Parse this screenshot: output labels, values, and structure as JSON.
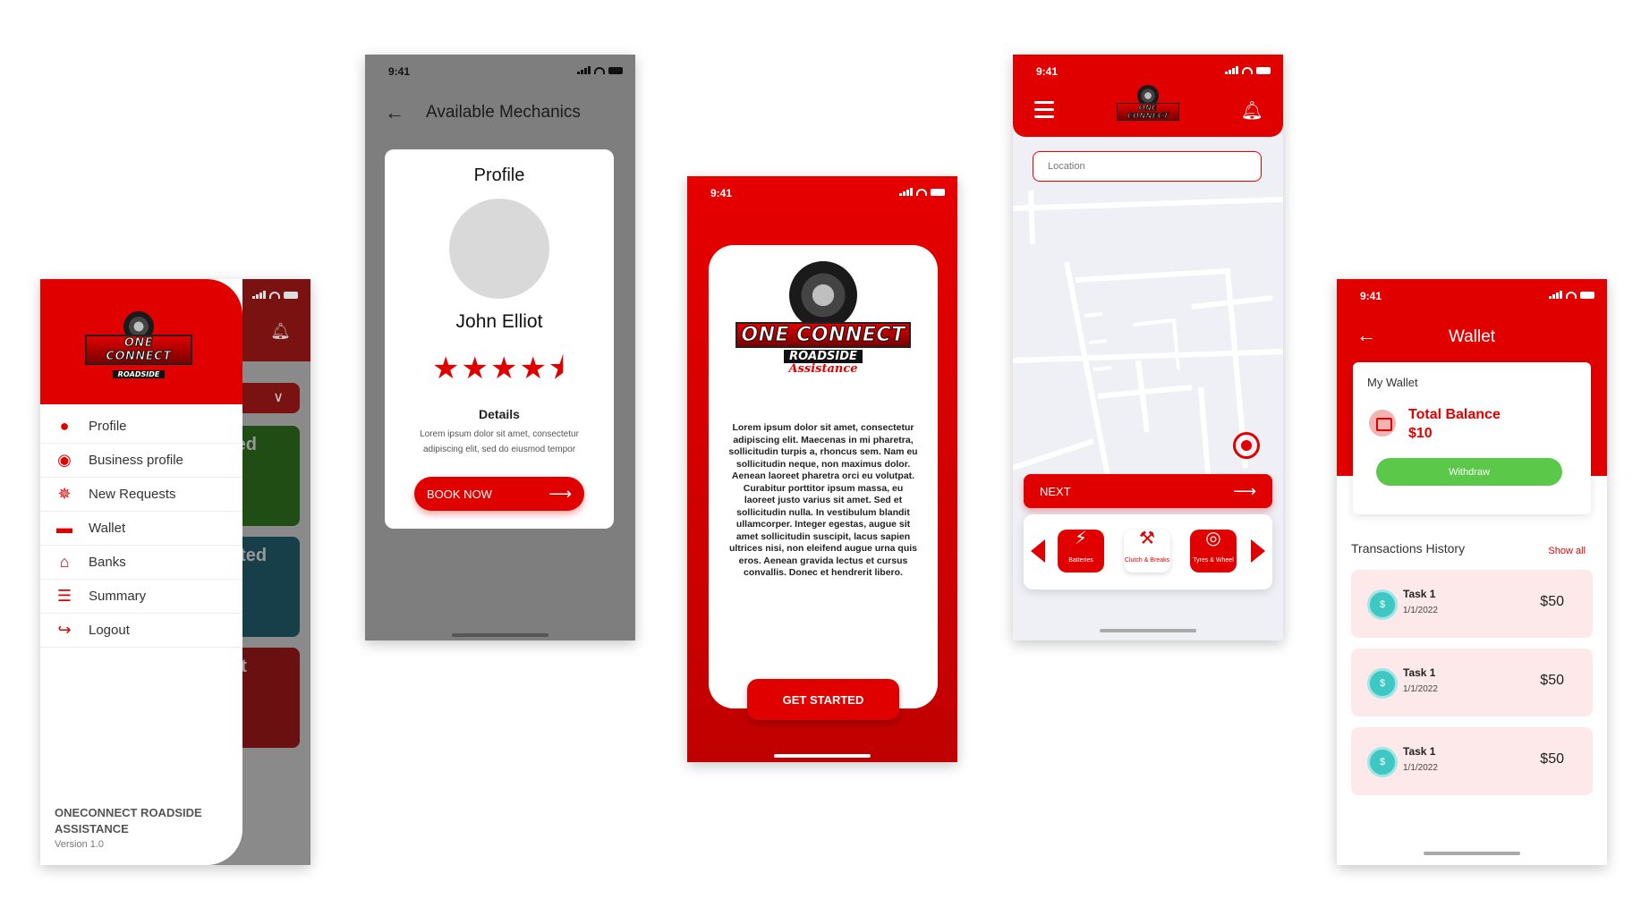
{
  "status_time": "9:41",
  "colors": {
    "brand_red": "#e00000",
    "withdraw_green": "#5cc84a",
    "coin_teal": "#3fc7c4"
  },
  "logo": {
    "line1": "ONE CONNECT",
    "line2": "ROADSIDE",
    "line3": "Assistance"
  },
  "menu_screen": {
    "items": [
      {
        "label": "Profile",
        "icon": "user-icon"
      },
      {
        "label": "Business profile",
        "icon": "steering-wheel-icon"
      },
      {
        "label": "New Requests",
        "icon": "spinner-icon"
      },
      {
        "label": "Wallet",
        "icon": "wallet-icon"
      },
      {
        "label": "Banks",
        "icon": "bank-icon"
      },
      {
        "label": "Summary",
        "icon": "document-icon"
      },
      {
        "label": "Logout",
        "icon": "logout-icon"
      }
    ],
    "footer_title": "ONECONNECT ROADSIDE ASSISTANCE",
    "footer_version": "Version 1.0",
    "background_fragments": [
      "ted",
      "ated",
      "nt"
    ]
  },
  "mechanics_screen": {
    "title": "Available Mechanics",
    "modal_title": "Profile",
    "name": "John Elliot",
    "rating": 4.5,
    "rating_max": 5,
    "details_heading": "Details",
    "details_text": "Lorem ipsum dolor sit amet, consectetur adipiscing elit, sed do eiusmod tempor",
    "book_label": "BOOK NOW"
  },
  "splash_screen": {
    "body": "Lorem ipsum dolor sit amet, consectetur adipiscing elit. Maecenas in mi pharetra, sollicitudin turpis a, rhoncus sem. Nam eu sollicitudin neque, non maximus dolor. Aenean laoreet pharetra orci eu volutpat. Curabitur porttitor ipsum massa, eu laoreet justo varius sit amet. Sed et sollicitudin nulla. In vestibulum blandit ullamcorper. Integer egestas, augue sit amet sollicitudin suscipit, lacus sapien ultrices nisi, non eleifend augue urna quis eros. Aenean gravida lectus et cursus convallis. Donec et hendrerit libero.",
    "cta": "GET STARTED"
  },
  "map_screen": {
    "location_placeholder": "Location",
    "next_label": "NEXT",
    "services": [
      {
        "label": "Batteries",
        "icon": "battery-icon",
        "selected": true
      },
      {
        "label": "Clutch & Breaks",
        "icon": "wrench-icon",
        "selected": false
      },
      {
        "label": "Tyres & Wheel",
        "icon": "tyre-icon",
        "selected": true
      }
    ]
  },
  "wallet_screen": {
    "title": "Wallet",
    "card_label": "My Wallet",
    "total_balance_label": "Total Balance",
    "total_balance_value": "$10",
    "withdraw_label": "Withdraw",
    "history_title": "Transactions History",
    "show_all": "Show all",
    "transactions": [
      {
        "name": "Task 1",
        "date": "1/1/2022",
        "amount": "$50"
      },
      {
        "name": "Task 1",
        "date": "1/1/2022",
        "amount": "$50"
      },
      {
        "name": "Task 1",
        "date": "1/1/2022",
        "amount": "$50"
      }
    ]
  }
}
